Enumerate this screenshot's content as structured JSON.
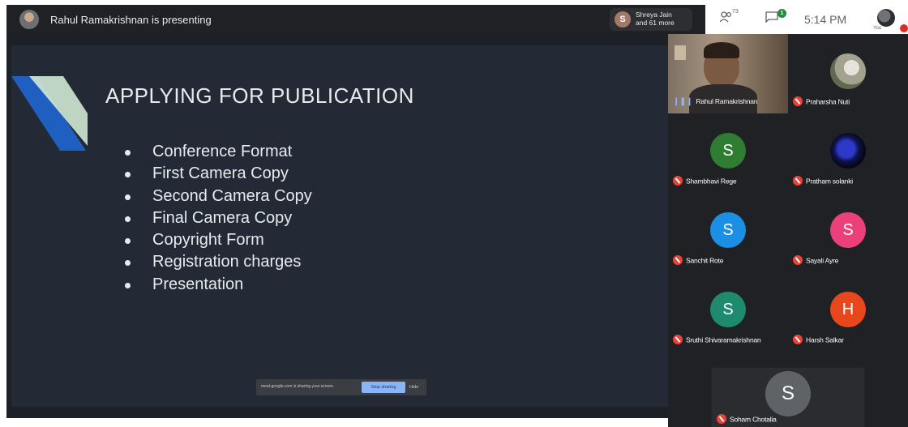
{
  "topbar": {
    "presenting_text": "Rahul Ramakrishnan is presenting",
    "viewers": {
      "initial": "S",
      "line1": "Shreya Jain",
      "line2": "and 61 more"
    },
    "people_count": "73",
    "chat_badge": "1",
    "time": "5:14 PM",
    "you_label": "You"
  },
  "slide": {
    "title": "APPLYING FOR PUBLICATION",
    "bullets": [
      "Conference Format",
      "First Camera Copy",
      "Second Camera Copy",
      "Final Camera Copy",
      "Copyright Form",
      "Registration charges",
      "Presentation"
    ],
    "accent_colors": {
      "blue": "#1f5fbf",
      "green": "#cfe8d4"
    }
  },
  "share_bar": {
    "text": "meet.google.com is sharing your screen.",
    "stop_label": "Stop sharing",
    "hide_label": "Hide"
  },
  "participants": [
    {
      "name": "Rahul Ramakrishnan",
      "type": "video",
      "speaking": true
    },
    {
      "name": "Praharsha Nuti",
      "type": "photo",
      "muted": true
    },
    {
      "name": "Shambhavi Rege",
      "initial": "S",
      "color": "#2e7d32",
      "muted": true
    },
    {
      "name": "Pratham solanki",
      "type": "photo",
      "muted": true
    },
    {
      "name": "Sanchit Rote",
      "initial": "S",
      "color": "#1a8fe3",
      "muted": true
    },
    {
      "name": "Sayali Ayre",
      "initial": "S",
      "color": "#ec407a",
      "muted": true
    },
    {
      "name": "Sruthi Shivaramakrishnan",
      "initial": "S",
      "color": "#1e8b6e",
      "muted": true
    },
    {
      "name": "Harsh Salkar",
      "initial": "H",
      "color": "#e8471c",
      "muted": true
    },
    {
      "name": "Soham Chotalia",
      "initial": "S",
      "color": "#5f6368",
      "muted": true
    }
  ]
}
